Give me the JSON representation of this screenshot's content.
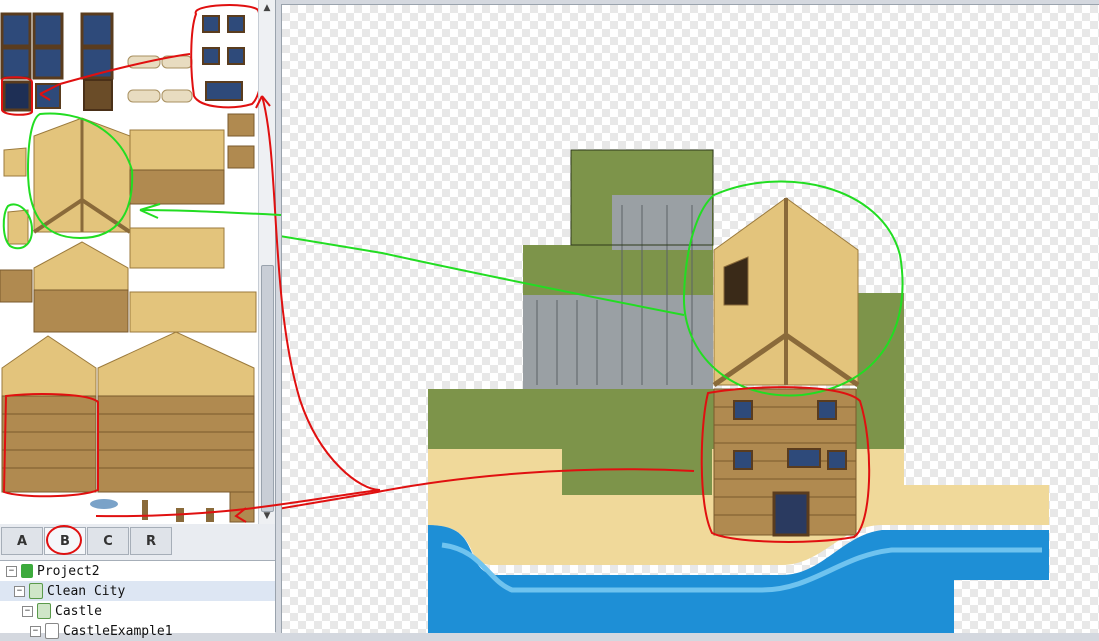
{
  "tabs": [
    "A",
    "B",
    "C",
    "R"
  ],
  "active_tab": "B",
  "tree": {
    "items": [
      {
        "label": "Project2",
        "expanded": true,
        "icon": "project-icon"
      },
      {
        "label": "Clean City",
        "expanded": true,
        "icon": "map-icon"
      },
      {
        "label": "Castle",
        "expanded": true,
        "icon": "map-icon"
      },
      {
        "label": "CastleExample1",
        "expanded": true,
        "icon": "map-icon"
      }
    ]
  },
  "colors": {
    "annotation_red": "#e01010",
    "annotation_green": "#22dd22",
    "grass": "#7d944a",
    "sand": "#f0d99a",
    "water": "#1e8fd6",
    "wood": "#8a6a3a",
    "thatch": "#e3c47c",
    "rock": "#9aa0a4"
  }
}
